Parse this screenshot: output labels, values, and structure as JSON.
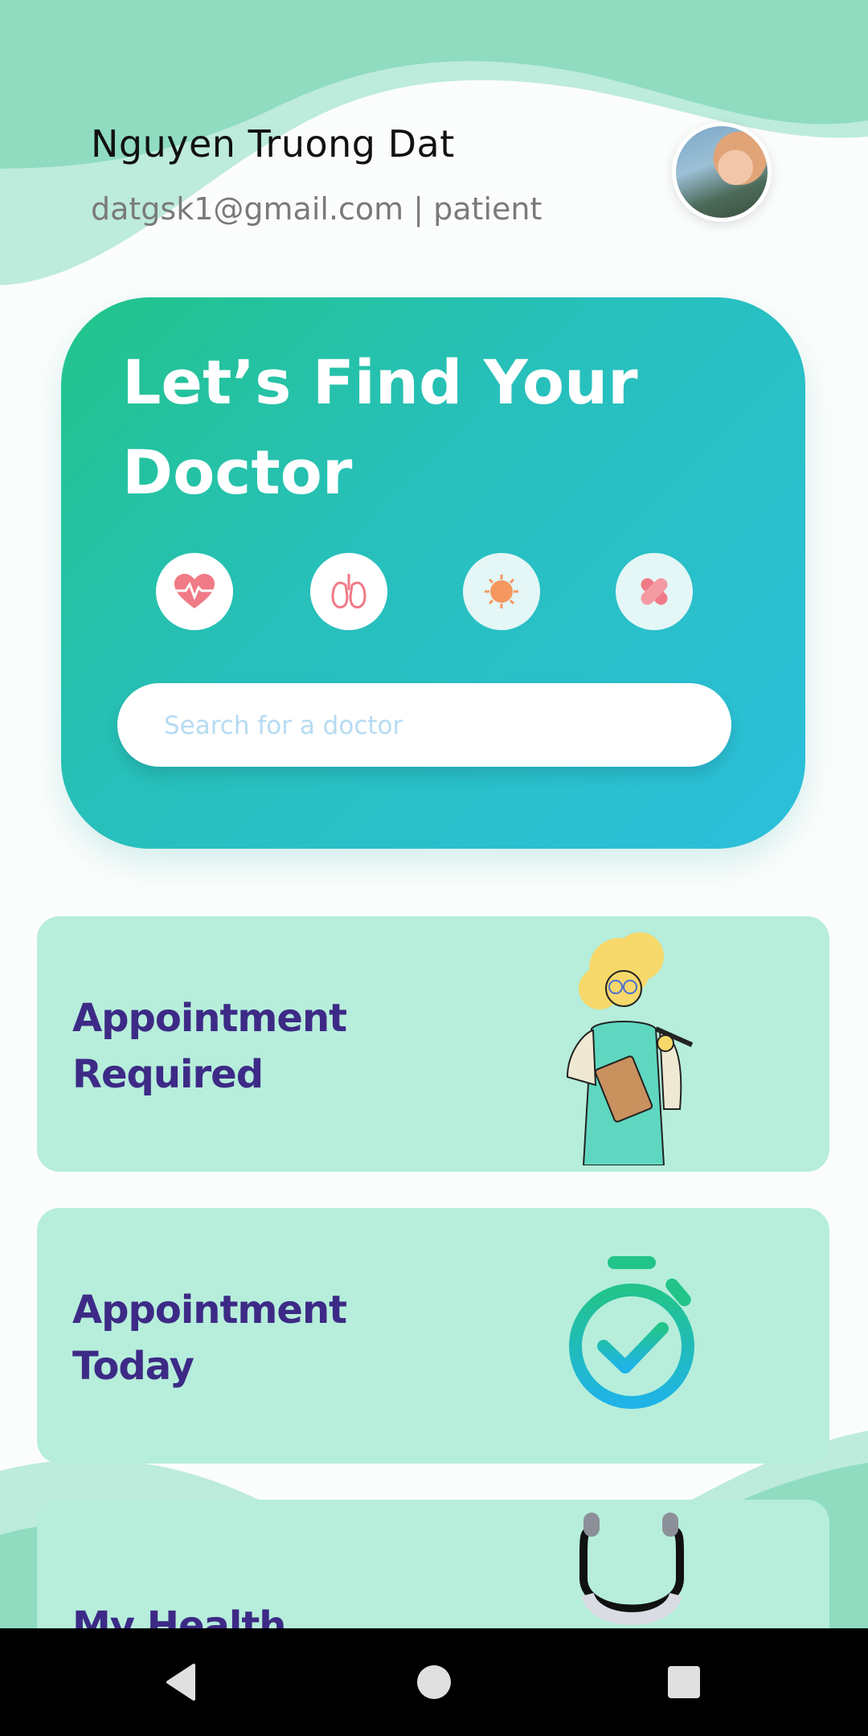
{
  "user": {
    "name": "Nguyen Truong Dat",
    "subtitle": "datgsk1@gmail.com | patient",
    "email": "datgsk1@gmail.com",
    "role": "patient"
  },
  "find_doctor": {
    "title_line1": "Let’s Find Your",
    "title_line2": "Doctor",
    "categories": [
      {
        "icon": "heart-pulse-icon"
      },
      {
        "icon": "lungs-icon"
      },
      {
        "icon": "virus-icon"
      },
      {
        "icon": "bandage-icon"
      }
    ],
    "search_placeholder": "Search for a doctor"
  },
  "tiles": [
    {
      "line1": "Appointment",
      "line2": "Required",
      "icon": "doctor-illustration"
    },
    {
      "line1": "Appointment",
      "line2": "Today",
      "icon": "stopwatch-check-icon"
    },
    {
      "line1": "My Health",
      "line2": "",
      "icon": "stethoscope-icon"
    }
  ],
  "colors": {
    "card_gradient_start": "#22c48a",
    "card_gradient_end": "#2cbfdc",
    "tile_bg": "#b6eedb",
    "tile_text": "#3d2a86",
    "wave": "#8fdcc0"
  },
  "nav": {
    "buttons": [
      "back-icon",
      "home-icon",
      "recents-icon"
    ]
  }
}
